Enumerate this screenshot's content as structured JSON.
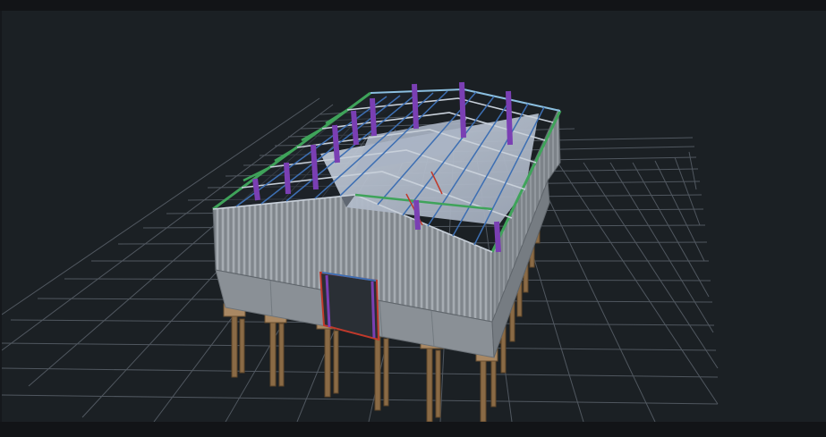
{
  "viewport": {
    "scene": "3d-model",
    "model": "steel-frame-warehouse",
    "colors": {
      "background": "#1b2024",
      "grid": "#5a6068",
      "cladding": "#9aa0a6",
      "roof_panel": "#b8c2d2",
      "purlin_blue": "#3d6fb3",
      "brace_green": "#3fa35a",
      "column_purple": "#7a3fb3",
      "pile_brown": "#8a6a45",
      "door_red": "#c0392b"
    }
  }
}
